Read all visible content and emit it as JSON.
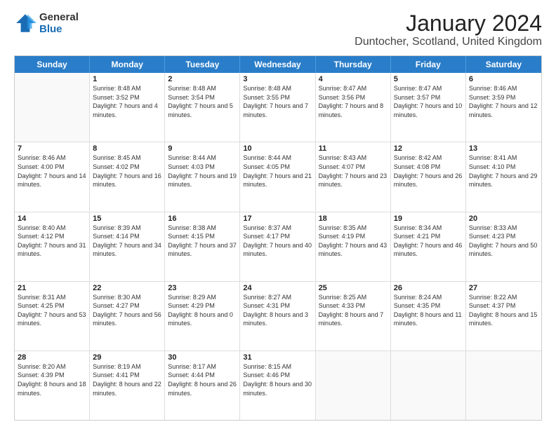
{
  "logo": {
    "general": "General",
    "blue": "Blue"
  },
  "title": "January 2024",
  "subtitle": "Duntocher, Scotland, United Kingdom",
  "headers": [
    "Sunday",
    "Monday",
    "Tuesday",
    "Wednesday",
    "Thursday",
    "Friday",
    "Saturday"
  ],
  "weeks": [
    [
      {
        "day": "",
        "sunrise": "",
        "sunset": "",
        "daylight": ""
      },
      {
        "day": "1",
        "sunrise": "Sunrise: 8:48 AM",
        "sunset": "Sunset: 3:52 PM",
        "daylight": "Daylight: 7 hours and 4 minutes."
      },
      {
        "day": "2",
        "sunrise": "Sunrise: 8:48 AM",
        "sunset": "Sunset: 3:54 PM",
        "daylight": "Daylight: 7 hours and 5 minutes."
      },
      {
        "day": "3",
        "sunrise": "Sunrise: 8:48 AM",
        "sunset": "Sunset: 3:55 PM",
        "daylight": "Daylight: 7 hours and 7 minutes."
      },
      {
        "day": "4",
        "sunrise": "Sunrise: 8:47 AM",
        "sunset": "Sunset: 3:56 PM",
        "daylight": "Daylight: 7 hours and 8 minutes."
      },
      {
        "day": "5",
        "sunrise": "Sunrise: 8:47 AM",
        "sunset": "Sunset: 3:57 PM",
        "daylight": "Daylight: 7 hours and 10 minutes."
      },
      {
        "day": "6",
        "sunrise": "Sunrise: 8:46 AM",
        "sunset": "Sunset: 3:59 PM",
        "daylight": "Daylight: 7 hours and 12 minutes."
      }
    ],
    [
      {
        "day": "7",
        "sunrise": "Sunrise: 8:46 AM",
        "sunset": "Sunset: 4:00 PM",
        "daylight": "Daylight: 7 hours and 14 minutes."
      },
      {
        "day": "8",
        "sunrise": "Sunrise: 8:45 AM",
        "sunset": "Sunset: 4:02 PM",
        "daylight": "Daylight: 7 hours and 16 minutes."
      },
      {
        "day": "9",
        "sunrise": "Sunrise: 8:44 AM",
        "sunset": "Sunset: 4:03 PM",
        "daylight": "Daylight: 7 hours and 19 minutes."
      },
      {
        "day": "10",
        "sunrise": "Sunrise: 8:44 AM",
        "sunset": "Sunset: 4:05 PM",
        "daylight": "Daylight: 7 hours and 21 minutes."
      },
      {
        "day": "11",
        "sunrise": "Sunrise: 8:43 AM",
        "sunset": "Sunset: 4:07 PM",
        "daylight": "Daylight: 7 hours and 23 minutes."
      },
      {
        "day": "12",
        "sunrise": "Sunrise: 8:42 AM",
        "sunset": "Sunset: 4:08 PM",
        "daylight": "Daylight: 7 hours and 26 minutes."
      },
      {
        "day": "13",
        "sunrise": "Sunrise: 8:41 AM",
        "sunset": "Sunset: 4:10 PM",
        "daylight": "Daylight: 7 hours and 29 minutes."
      }
    ],
    [
      {
        "day": "14",
        "sunrise": "Sunrise: 8:40 AM",
        "sunset": "Sunset: 4:12 PM",
        "daylight": "Daylight: 7 hours and 31 minutes."
      },
      {
        "day": "15",
        "sunrise": "Sunrise: 8:39 AM",
        "sunset": "Sunset: 4:14 PM",
        "daylight": "Daylight: 7 hours and 34 minutes."
      },
      {
        "day": "16",
        "sunrise": "Sunrise: 8:38 AM",
        "sunset": "Sunset: 4:15 PM",
        "daylight": "Daylight: 7 hours and 37 minutes."
      },
      {
        "day": "17",
        "sunrise": "Sunrise: 8:37 AM",
        "sunset": "Sunset: 4:17 PM",
        "daylight": "Daylight: 7 hours and 40 minutes."
      },
      {
        "day": "18",
        "sunrise": "Sunrise: 8:35 AM",
        "sunset": "Sunset: 4:19 PM",
        "daylight": "Daylight: 7 hours and 43 minutes."
      },
      {
        "day": "19",
        "sunrise": "Sunrise: 8:34 AM",
        "sunset": "Sunset: 4:21 PM",
        "daylight": "Daylight: 7 hours and 46 minutes."
      },
      {
        "day": "20",
        "sunrise": "Sunrise: 8:33 AM",
        "sunset": "Sunset: 4:23 PM",
        "daylight": "Daylight: 7 hours and 50 minutes."
      }
    ],
    [
      {
        "day": "21",
        "sunrise": "Sunrise: 8:31 AM",
        "sunset": "Sunset: 4:25 PM",
        "daylight": "Daylight: 7 hours and 53 minutes."
      },
      {
        "day": "22",
        "sunrise": "Sunrise: 8:30 AM",
        "sunset": "Sunset: 4:27 PM",
        "daylight": "Daylight: 7 hours and 56 minutes."
      },
      {
        "day": "23",
        "sunrise": "Sunrise: 8:29 AM",
        "sunset": "Sunset: 4:29 PM",
        "daylight": "Daylight: 8 hours and 0 minutes."
      },
      {
        "day": "24",
        "sunrise": "Sunrise: 8:27 AM",
        "sunset": "Sunset: 4:31 PM",
        "daylight": "Daylight: 8 hours and 3 minutes."
      },
      {
        "day": "25",
        "sunrise": "Sunrise: 8:25 AM",
        "sunset": "Sunset: 4:33 PM",
        "daylight": "Daylight: 8 hours and 7 minutes."
      },
      {
        "day": "26",
        "sunrise": "Sunrise: 8:24 AM",
        "sunset": "Sunset: 4:35 PM",
        "daylight": "Daylight: 8 hours and 11 minutes."
      },
      {
        "day": "27",
        "sunrise": "Sunrise: 8:22 AM",
        "sunset": "Sunset: 4:37 PM",
        "daylight": "Daylight: 8 hours and 15 minutes."
      }
    ],
    [
      {
        "day": "28",
        "sunrise": "Sunrise: 8:20 AM",
        "sunset": "Sunset: 4:39 PM",
        "daylight": "Daylight: 8 hours and 18 minutes."
      },
      {
        "day": "29",
        "sunrise": "Sunrise: 8:19 AM",
        "sunset": "Sunset: 4:41 PM",
        "daylight": "Daylight: 8 hours and 22 minutes."
      },
      {
        "day": "30",
        "sunrise": "Sunrise: 8:17 AM",
        "sunset": "Sunset: 4:44 PM",
        "daylight": "Daylight: 8 hours and 26 minutes."
      },
      {
        "day": "31",
        "sunrise": "Sunrise: 8:15 AM",
        "sunset": "Sunset: 4:46 PM",
        "daylight": "Daylight: 8 hours and 30 minutes."
      },
      {
        "day": "",
        "sunrise": "",
        "sunset": "",
        "daylight": ""
      },
      {
        "day": "",
        "sunrise": "",
        "sunset": "",
        "daylight": ""
      },
      {
        "day": "",
        "sunrise": "",
        "sunset": "",
        "daylight": ""
      }
    ]
  ]
}
